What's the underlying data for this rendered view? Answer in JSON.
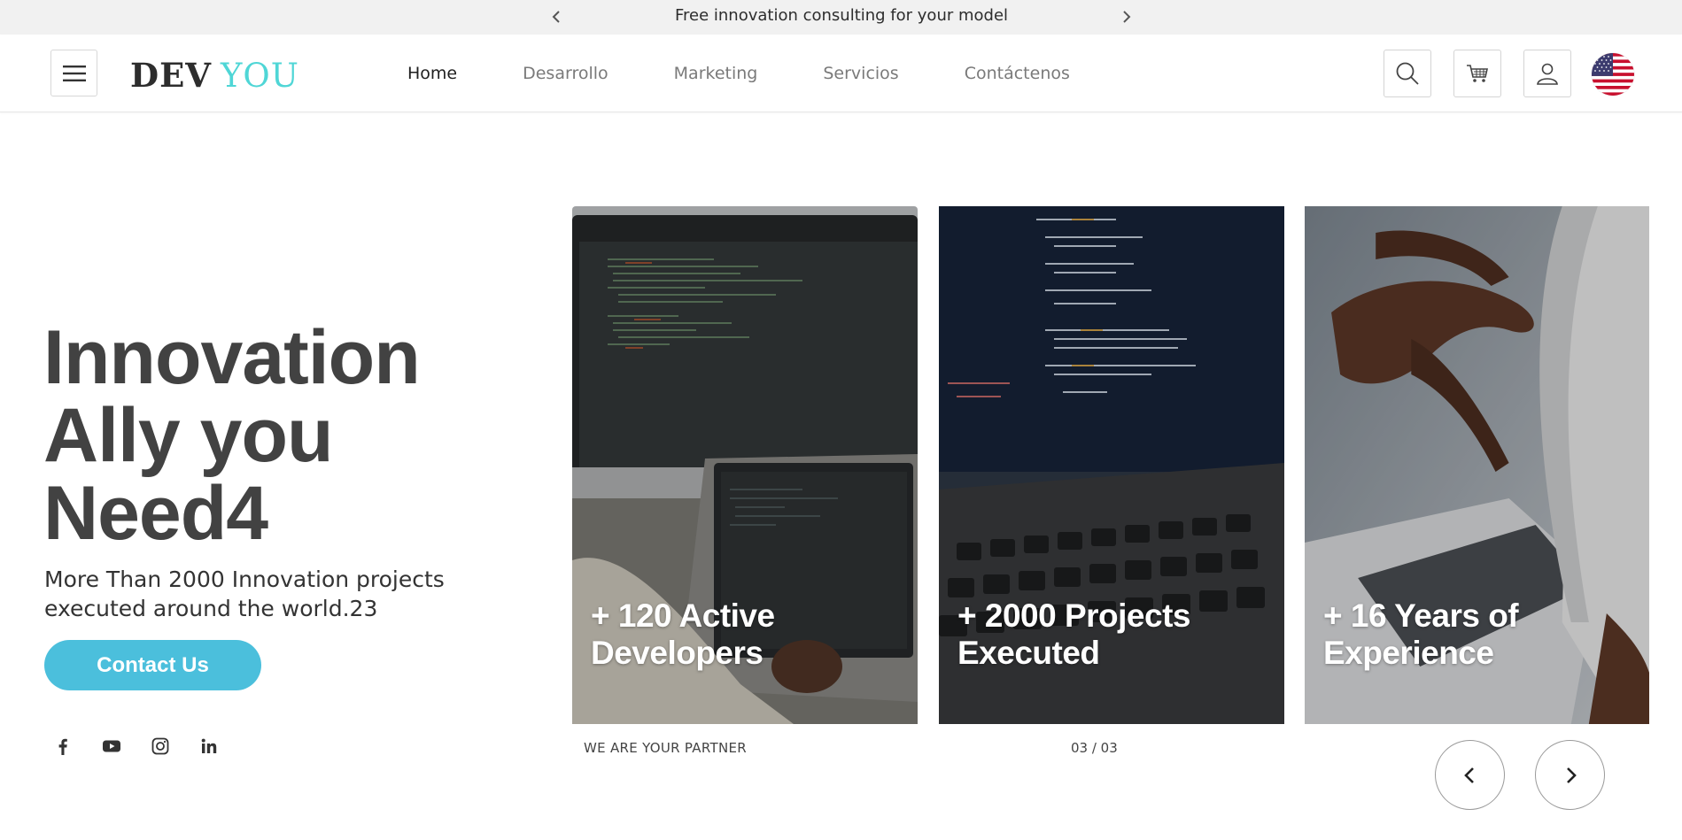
{
  "announcement": {
    "text": "Free innovation consulting for your model",
    "prev_icon": "chevron-left-icon",
    "next_icon": "chevron-right-icon"
  },
  "header": {
    "logo_dev": "DEV",
    "logo_you": "YOU",
    "logo_accent_color": "#4fd6d6",
    "nav": [
      {
        "label": "Home",
        "active": true
      },
      {
        "label": "Desarrollo",
        "active": false
      },
      {
        "label": "Marketing",
        "active": false
      },
      {
        "label": "Servicios",
        "active": false
      },
      {
        "label": "Contáctenos",
        "active": false
      }
    ],
    "icons": [
      "menu-icon",
      "search-icon",
      "cart-icon",
      "user-icon",
      "us-flag-icon"
    ]
  },
  "hero": {
    "title": "Innovation\nAlly you\nNeed4",
    "subtitle": "More Than 2000 Innovation projects executed around the world.23",
    "cta_label": "Contact Us",
    "cta_color": "#4bbfdc",
    "socials": [
      "facebook-icon",
      "youtube-icon",
      "instagram-icon",
      "linkedin-icon"
    ]
  },
  "slider": {
    "cards": [
      {
        "caption": "+ 120 Active\nDevelopers"
      },
      {
        "caption": "+ 2000 Projects\nExecuted"
      },
      {
        "caption": "+ 16 Years of\nExperience"
      }
    ],
    "tagline": "WE ARE YOUR PARTNER",
    "counter": "03 / 03"
  }
}
